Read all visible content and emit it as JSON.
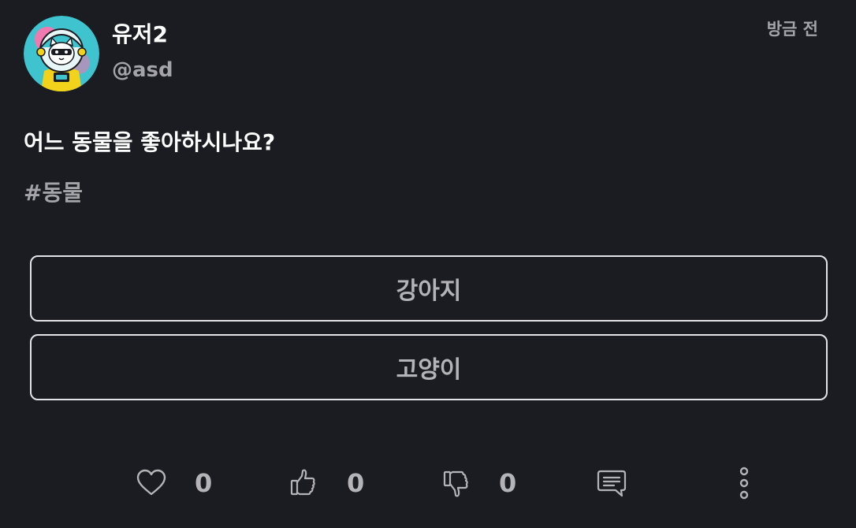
{
  "post": {
    "author_name": "유저2",
    "author_handle": "@asd",
    "timestamp": "방금 전",
    "question": "어느 동물을 좋아하시나요?",
    "hashtag": "#동물",
    "options": [
      {
        "label": "강아지"
      },
      {
        "label": "고양이"
      }
    ]
  },
  "actions": {
    "likes": "0",
    "upvotes": "0",
    "downvotes": "0",
    "icons": [
      "heart-icon",
      "thumbs-up-icon",
      "thumbs-down-icon",
      "comment-icon",
      "more-vertical-icon"
    ]
  },
  "colors": {
    "background": "#1b1c21",
    "text_primary": "#ffffff",
    "text_secondary": "#a3a3a8",
    "option_border": "#e4e4e8",
    "avatar_bg": "#3ec3cf"
  }
}
